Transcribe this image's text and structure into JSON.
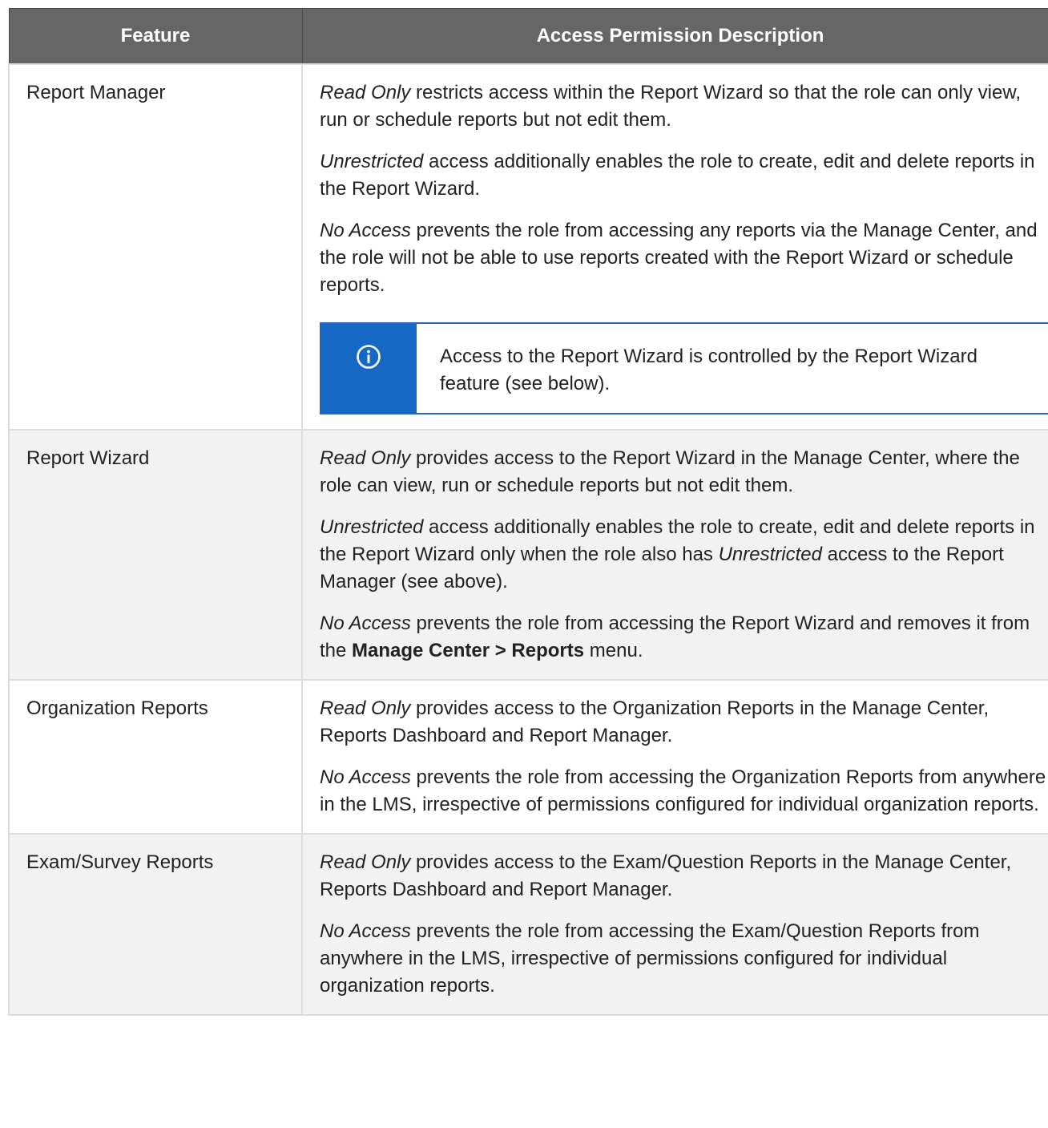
{
  "table": {
    "headers": [
      "Feature",
      "Access Permission Description"
    ],
    "rows": [
      {
        "feature": "Report Manager",
        "paragraphs": [
          [
            {
              "t": "Read Only",
              "s": "i"
            },
            {
              "t": " restricts access within the Report Wizard so that the role can only view, run or schedule reports but not edit them."
            }
          ],
          [
            {
              "t": "Unrestricted",
              "s": "i"
            },
            {
              "t": " access additionally enables the role to create, edit and delete reports in the Report Wizard."
            }
          ],
          [
            {
              "t": "No Access",
              "s": "i"
            },
            {
              "t": " prevents the role from accessing any reports via the Manage Center, and the role will not be able to use reports created with the Report Wizard or schedule reports."
            }
          ]
        ],
        "note": {
          "icon": "info-icon",
          "text": "Access to the Report Wizard is controlled by the Report Wizard feature (see below)."
        }
      },
      {
        "feature": "Report Wizard",
        "paragraphs": [
          [
            {
              "t": "Read Only",
              "s": "i"
            },
            {
              "t": " provides access to the Report Wizard in the Manage Center, where the role can view, run or schedule reports but not edit them."
            }
          ],
          [
            {
              "t": "Unrestricted",
              "s": "i"
            },
            {
              "t": " access additionally enables the role to create, edit and delete reports in the Report Wizard only when the role also has "
            },
            {
              "t": "Unrestricted",
              "s": "i"
            },
            {
              "t": " access to the Report Manager (see above)."
            }
          ],
          [
            {
              "t": "No Access",
              "s": "i"
            },
            {
              "t": " prevents the role from accessing the Report Wizard and removes it from the "
            },
            {
              "t": "Manage Center > Reports",
              "s": "b"
            },
            {
              "t": " menu."
            }
          ]
        ]
      },
      {
        "feature": "Organization Reports",
        "paragraphs": [
          [
            {
              "t": "Read Only",
              "s": "i"
            },
            {
              "t": " provides access to the Organization Reports in the Manage Center, Reports Dashboard and Report Manager."
            }
          ],
          [
            {
              "t": "No Access",
              "s": "i"
            },
            {
              "t": " prevents the role from accessing the Organization Reports from anywhere in the LMS, irrespective of permissions configured for individual organization reports."
            }
          ]
        ]
      },
      {
        "feature": "Exam/Survey Reports",
        "paragraphs": [
          [
            {
              "t": "Read Only",
              "s": "i"
            },
            {
              "t": " provides access to the Exam/Question Reports in the Manage Center, Reports Dashboard and Report Manager."
            }
          ],
          [
            {
              "t": "No Access",
              "s": "i"
            },
            {
              "t": " prevents the role from accessing the Exam/Question Reports from anywhere in the LMS, irrespective of permissions configured for individual organization reports."
            }
          ]
        ]
      }
    ]
  },
  "colors": {
    "header_bg": "#666666",
    "alt_row_bg": "#f2f2f2",
    "note_accent": "#1668c4"
  }
}
